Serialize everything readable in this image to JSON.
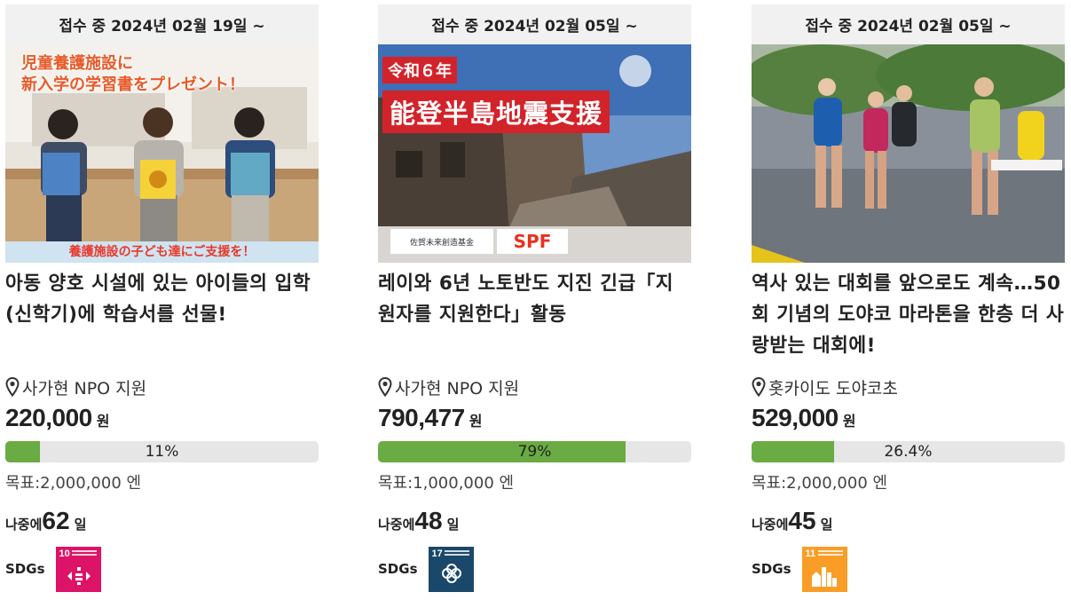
{
  "projects": [
    {
      "status": "접수 중 2024년 02월 19일 ~",
      "title": "아동 양호 시설에 있는 아이들의 입학(신학기)에 학습서를 선물!",
      "location": "사가현 NPO 지원",
      "amount": "220,000",
      "amount_unit": "원",
      "progress_label": "11%",
      "progress_fraction": 0.11,
      "goal": "목표:2,000,000 엔",
      "remaining_label": "나중에",
      "remaining_days": "62",
      "days_unit": "일",
      "sdgs_label": "SDGs",
      "sdg_number": "10",
      "sdg_color": "#dd1367",
      "image_caption_top": "児童養護施設に\n新入学の学習書をプレゼント！",
      "image_caption_bottom": "養護施設の子ども達にご支援を！"
    },
    {
      "status": "접수 중 2024년 02월 05일 ~",
      "title": "레이와 6년 노토반도 지진 긴급「지원자를 지원한다」활동",
      "location": "사가현 NPO 지원",
      "amount": "790,477",
      "amount_unit": "원",
      "progress_label": "79%",
      "progress_fraction": 0.79,
      "goal": "목표:1,000,000 엔",
      "remaining_label": "나중에",
      "remaining_days": "48",
      "days_unit": "일",
      "sdgs_label": "SDGs",
      "sdg_number": "17",
      "sdg_color": "#19486a",
      "image_caption_top": "令和６年",
      "image_caption_main": "能登半島地震支援",
      "image_logo_left": "佐賀未来創造基金",
      "image_logo_right": "SPF"
    },
    {
      "status": "접수 중 2024년 02월 05일 ~",
      "title": "역사 있는 대회를 앞으로도 계속…50회 기념의 도야코 마라톤을 한층 더 사랑받는 대회에!",
      "location": "홋카이도 도야코초",
      "amount": "529,000",
      "amount_unit": "원",
      "progress_label": "26.4%",
      "progress_fraction": 0.264,
      "goal": "목표:2,000,000 엔",
      "remaining_label": "나중에",
      "remaining_days": "45",
      "days_unit": "일",
      "sdgs_label": "SDGs",
      "sdg_number": "11",
      "sdg_color": "#f99d26"
    }
  ],
  "colors": {
    "progress_fill": "#6aab43",
    "progress_track": "#e6e6e6",
    "status_bg": "#f1f1f1"
  },
  "icons": {
    "location": "map-pin-icon",
    "sdg_10": "reduced-inequalities-icon",
    "sdg_17": "partnerships-icon",
    "sdg_11": "sustainable-cities-icon"
  }
}
